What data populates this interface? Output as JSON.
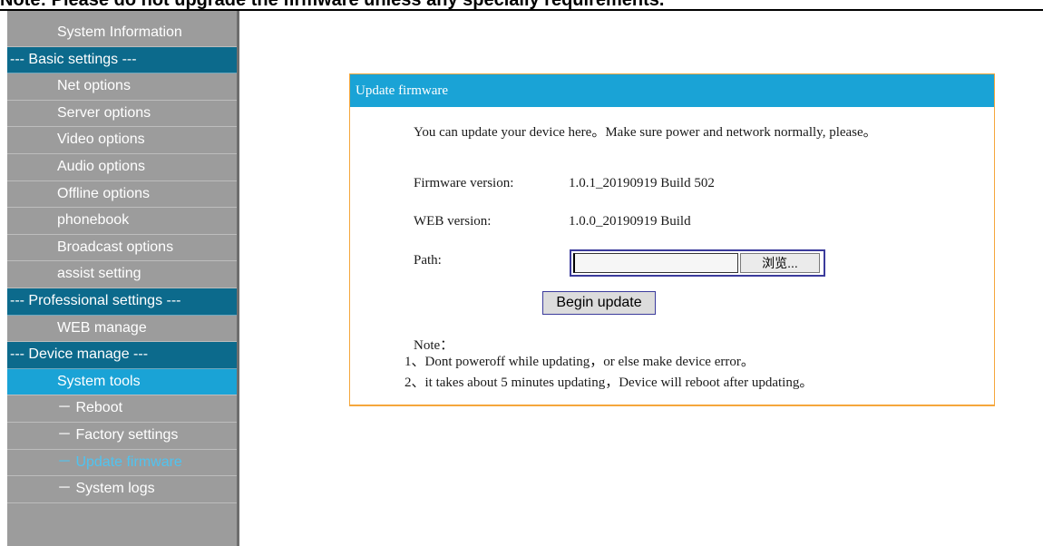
{
  "banner": {
    "text": "Note: Please do not upgrade the firmware unless any specially requirements."
  },
  "sidebar": {
    "items": [
      {
        "label": "System Information",
        "type": "link"
      },
      {
        "label": "--- Basic settings ---",
        "type": "section"
      },
      {
        "label": "Net options",
        "type": "link"
      },
      {
        "label": "Server options",
        "type": "link"
      },
      {
        "label": "Video options",
        "type": "link"
      },
      {
        "label": "Audio options",
        "type": "link"
      },
      {
        "label": "Offline options",
        "type": "link"
      },
      {
        "label": "phonebook",
        "type": "link"
      },
      {
        "label": "Broadcast options",
        "type": "link"
      },
      {
        "label": "assist setting",
        "type": "link"
      },
      {
        "label": "--- Professional settings ---",
        "type": "section"
      },
      {
        "label": "WEB manage",
        "type": "link"
      },
      {
        "label": "--- Device manage ---",
        "type": "section"
      },
      {
        "label": "System tools",
        "type": "active-section"
      },
      {
        "label": "－ Reboot",
        "type": "sub"
      },
      {
        "label": "－ Factory settings",
        "type": "sub"
      },
      {
        "label": "－ Update firmware",
        "type": "sub-current"
      },
      {
        "label": "－ System logs",
        "type": "sub"
      }
    ]
  },
  "panel": {
    "title": "Update firmware",
    "intro": "You can update your device here。Make sure power and network normally, please。",
    "firmware_label": "Firmware version:",
    "firmware_value": "1.0.1_20190919 Build 502",
    "web_label": "WEB version:",
    "web_value": "1.0.0_20190919 Build",
    "path_label": "Path:",
    "path_value": "",
    "browse_label": "浏览...",
    "begin_label": "Begin update",
    "note_title": "Note：",
    "note_1": "1、Dont poweroff while updating，or else make device error。",
    "note_2": "2、it takes about 5 minutes updating，Device will reboot after updating。"
  },
  "colors": {
    "sidebar_bg": "#9c9c9c",
    "section_bg": "#0c6a8c",
    "active_bg": "#1aa3d6",
    "current_text": "#4fc3f0",
    "panel_border": "#f5a63c",
    "panel_header": "#1aa3d6"
  }
}
